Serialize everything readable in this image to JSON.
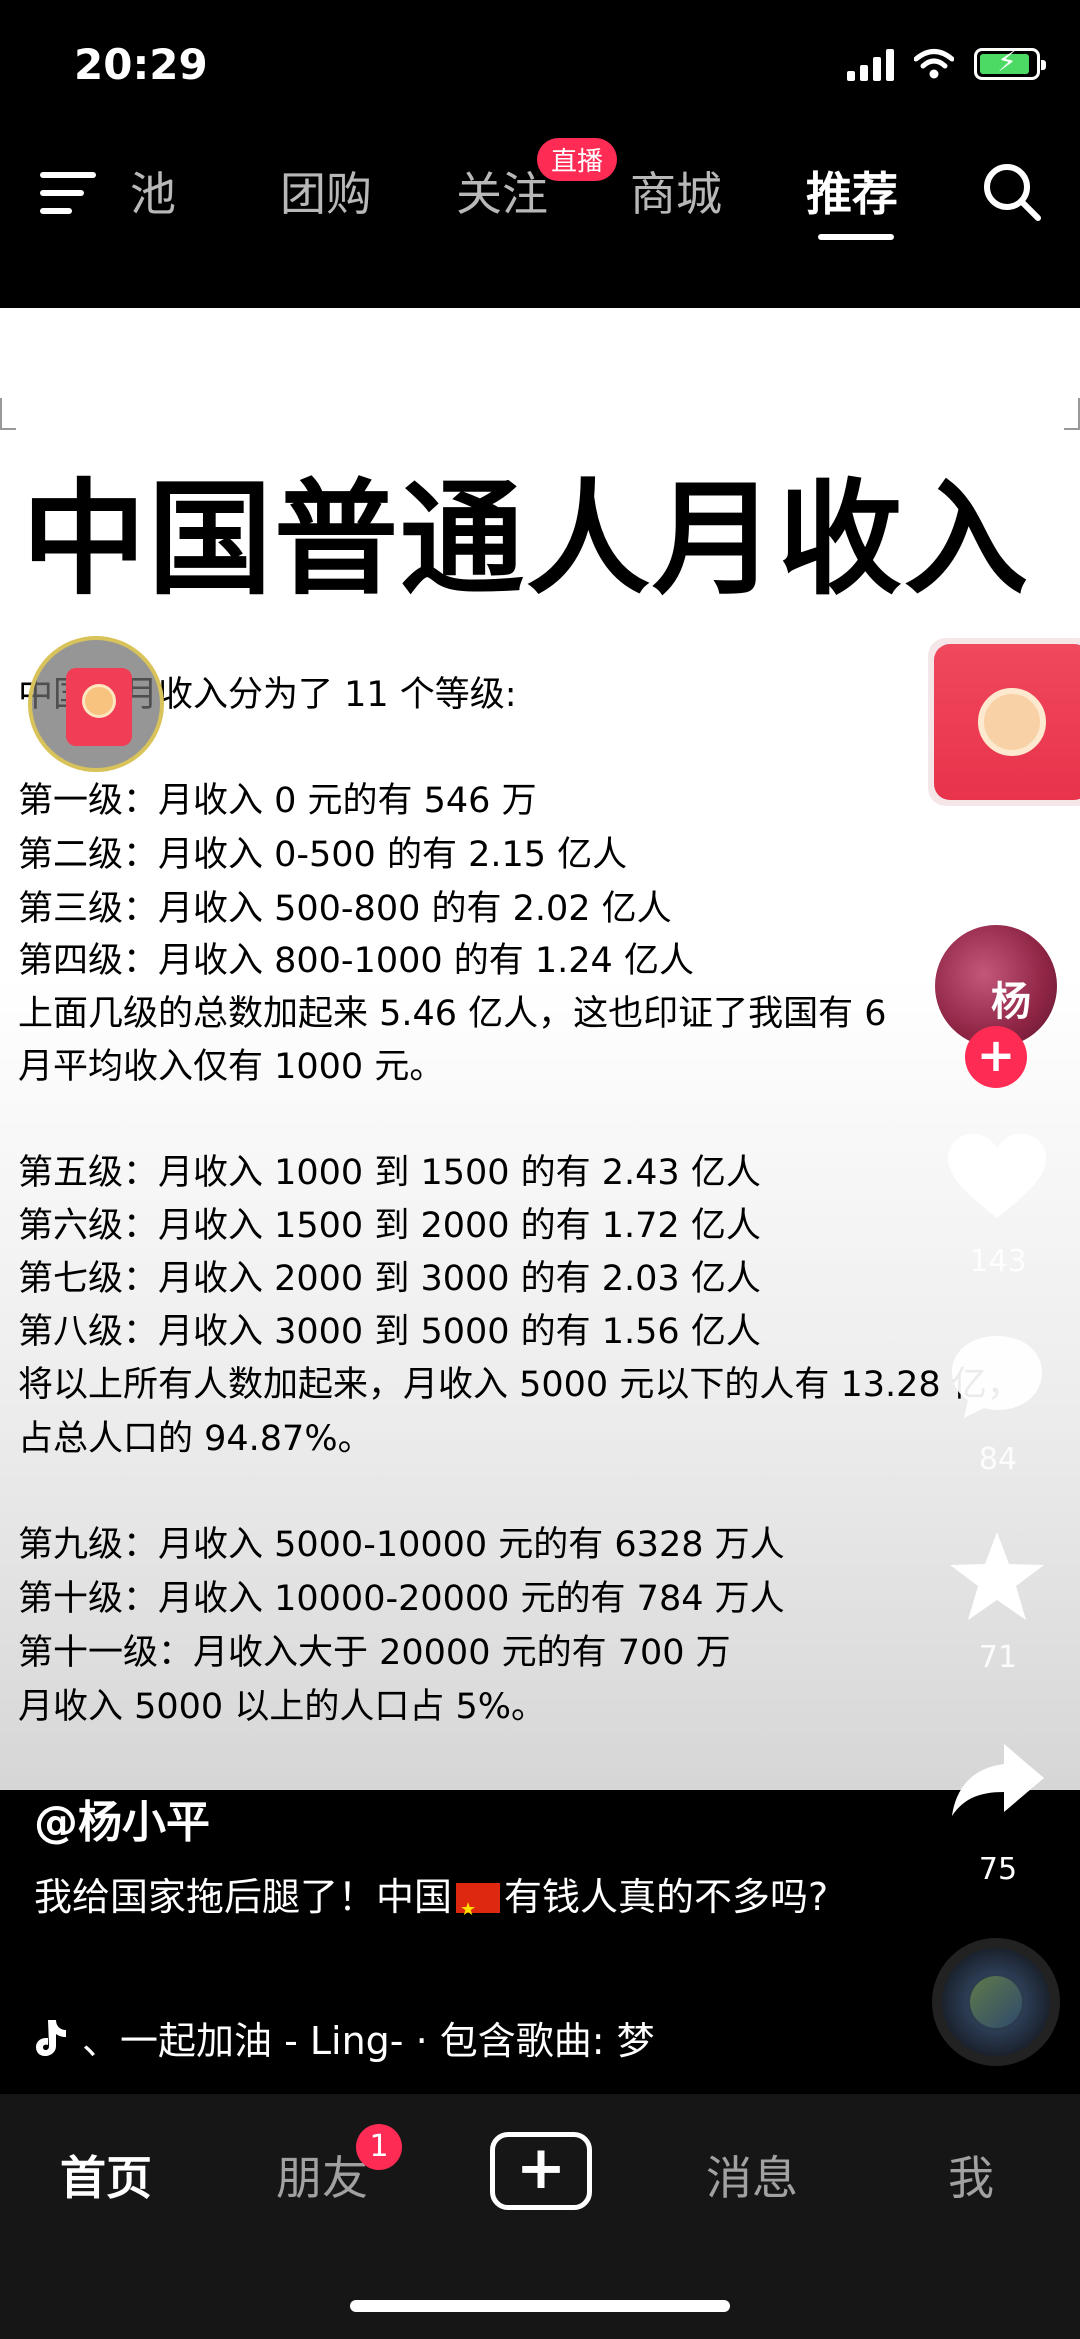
{
  "status_bar": {
    "time": "20:29"
  },
  "top_nav": {
    "tabs": [
      {
        "label": "池",
        "active": false
      },
      {
        "label": "团购",
        "active": false
      },
      {
        "label": "关注",
        "active": false
      },
      {
        "label": "商城",
        "active": false
      },
      {
        "label": "推荐",
        "active": true
      }
    ],
    "live_badge": "直播"
  },
  "post": {
    "headline": "中国普通人月收入",
    "lines": [
      "中国的月收入分为了 11 个等级:",
      "第一级：月收入 0 元的有 546 万",
      "第二级：月收入 0-500 的有 2.15 亿人",
      "第三级：月收入 500-800 的有 2.02 亿人",
      "第四级：月收入 800-1000 的有 1.24 亿人",
      "上面几级的总数加起来 5.46 亿人，这也印证了我国有 6",
      "月平均收入仅有 1000 元。",
      "第五级：月收入 1000 到 1500 的有 2.43 亿人",
      "第六级：月收入 1500 到 2000 的有 1.72 亿人",
      "第七级：月收入 2000 到 3000 的有 2.03 亿人",
      "第八级：月收入 3000 到 5000 的有 1.56 亿人",
      "将以上所有人数加起来，月收入 5000 元以下的人有 13.28 亿，",
      "占总人口的 94.87%。",
      "第九级：月收入 5000-10000 元的有 6328 万人",
      "第十级：月收入 10000-20000 元的有 784 万人",
      "第十一级：月收入大于 20000 元的有 700 万",
      "月收入 5000 以上的人口占 5%。"
    ]
  },
  "rail": {
    "likes": "143",
    "comments": "84",
    "favorites": "71",
    "shares": "75"
  },
  "caption": {
    "author": "@杨小平",
    "text_before_flag": "我给国家拖后腿了！中国",
    "text_after_flag": "有钱人真的不多吗?",
    "music": "、一起加油 - Ling- · 包含歌曲: 梦"
  },
  "bottom_nav": {
    "home": "首页",
    "friends": "朋友",
    "friends_badge": "1",
    "messages": "消息",
    "me": "我"
  },
  "colors": {
    "accent": "#fe2c55",
    "battery": "#4cd964"
  }
}
